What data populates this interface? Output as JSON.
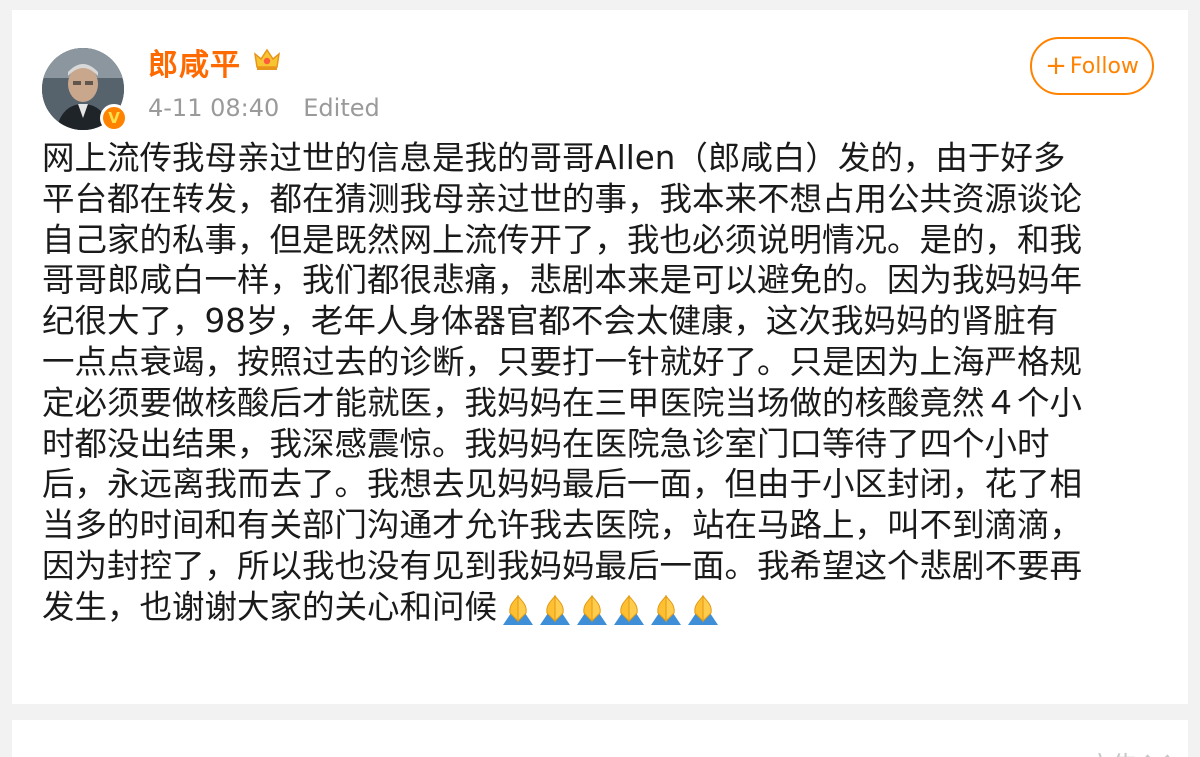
{
  "post": {
    "author": {
      "name": "郎咸平",
      "badge_icon": "vip-crown-icon",
      "verified_icon": "verified-v-icon",
      "verified_mark": "V"
    },
    "meta": {
      "timestamp": "4-11 08:40",
      "edited_label": "Edited"
    },
    "follow_button": {
      "plus": "+",
      "label": "Follow"
    },
    "text_lines": [
      "网上流传我母亲过世的信息是我的哥哥Allen（郎咸白）发的，由于好多",
      "平台都在转发，都在猜测我母亲过世的事，我本来不想占用公共资源谈论",
      "自己家的私事，但是既然网上流传开了，我也必须说明情况。是的，和我",
      "哥哥郎咸白一样，我们都很悲痛，悲剧本来是可以避免的。因为我妈妈年",
      "纪很大了，98岁，老年人身体器官都不会太健康，这次我妈妈的肾脏有",
      "一点点衰竭，按照过去的诊断，只要打一针就好了。只是因为上海严格规",
      "定必须要做核酸后才能就医，我妈妈在三甲医院当场做的核酸竟然４个小",
      "时都没出结果，我深感震惊。我妈妈在医院急诊室门口等待了四个小时",
      "后，永远离我而去了。我想去见妈妈最后一面，但由于小区封闭，花了相",
      "当多的时间和有关部门沟通才允许我去医院，站在马路上，叫不到滴滴，",
      "因为封控了，所以我也没有见到我妈妈最后一面。我希望这个悲剧不要再",
      "发生，也谢谢大家的关心和问候"
    ],
    "emoji": {
      "name": "folded-hands-icon",
      "count": 6
    }
  },
  "next_card": {
    "ad_label": "广告"
  },
  "colors": {
    "accent": "#ff8200",
    "username": "#ff6a00",
    "meta_text": "#9a9a9a",
    "body_text": "#1a1a1a",
    "background": "#f2f2f2"
  }
}
